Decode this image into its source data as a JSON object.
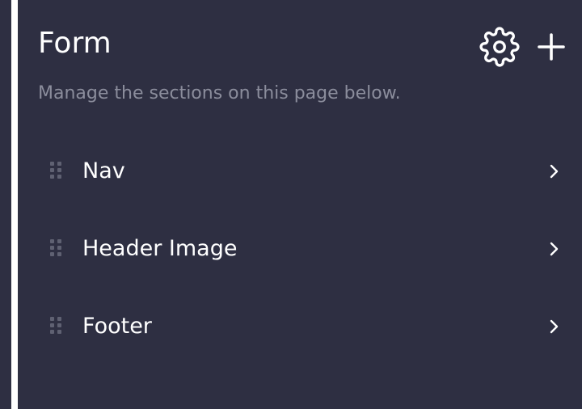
{
  "panel": {
    "title": "Form",
    "subtitle": "Manage the sections on this page below.",
    "icons": {
      "settings": "gear-icon",
      "add": "plus-icon",
      "drag": "drag-handle-icon",
      "chevron": "chevron-right-icon"
    },
    "colors": {
      "background": "#2e2f42",
      "text": "#ffffff",
      "muted": "#8b8d9c",
      "accent_border": "#ffffff"
    }
  },
  "sections": [
    {
      "label": "Nav"
    },
    {
      "label": "Header Image"
    },
    {
      "label": "Footer"
    }
  ]
}
